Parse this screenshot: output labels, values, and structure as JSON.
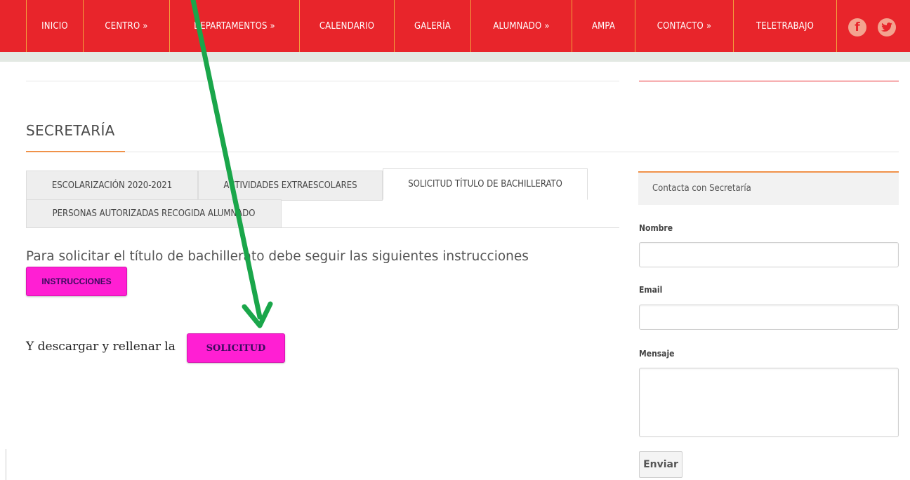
{
  "nav": {
    "items": [
      "INICIO",
      "CENTRO »",
      "DEPARTAMENTOS »",
      "CALENDARIO",
      "GALERÍA",
      "ALUMNADO »",
      "AMPA",
      "CONTACTO »",
      "TELETRABAJO"
    ],
    "social": [
      "facebook-icon",
      "twitter-icon"
    ]
  },
  "page": {
    "title": "SECRETARÍA",
    "tabs": [
      "ESCOLARIZACIÓN 2020-2021",
      "ACTIVIDADES EXTRAESCOLARES",
      "SOLICITUD TÍTULO DE BACHILLERATO",
      "PERSONAS AUTORIZADAS RECOGIDA ALUMNADO"
    ],
    "active_tab": "SOLICITUD TÍTULO DE BACHILLERATO",
    "intro": "Para solicitar el título de bachillerato debe seguir las siguientes instrucciones",
    "instructions_button": "INSTRUCCIONES",
    "download_text": "Y descargar y rellenar la",
    "solicitud_button": "SOLICITUD"
  },
  "sidebar": {
    "box_title": "Contacta con Secretaría",
    "name_label": "Nombre",
    "email_label": "Email",
    "message_label": "Mensaje",
    "send_label": "Enviar"
  },
  "colors": {
    "nav_red": "#e8252b",
    "pink_button": "#ff1fd3",
    "annotation_arrow": "#1aa64a",
    "accent_orange": "#f0924a"
  }
}
